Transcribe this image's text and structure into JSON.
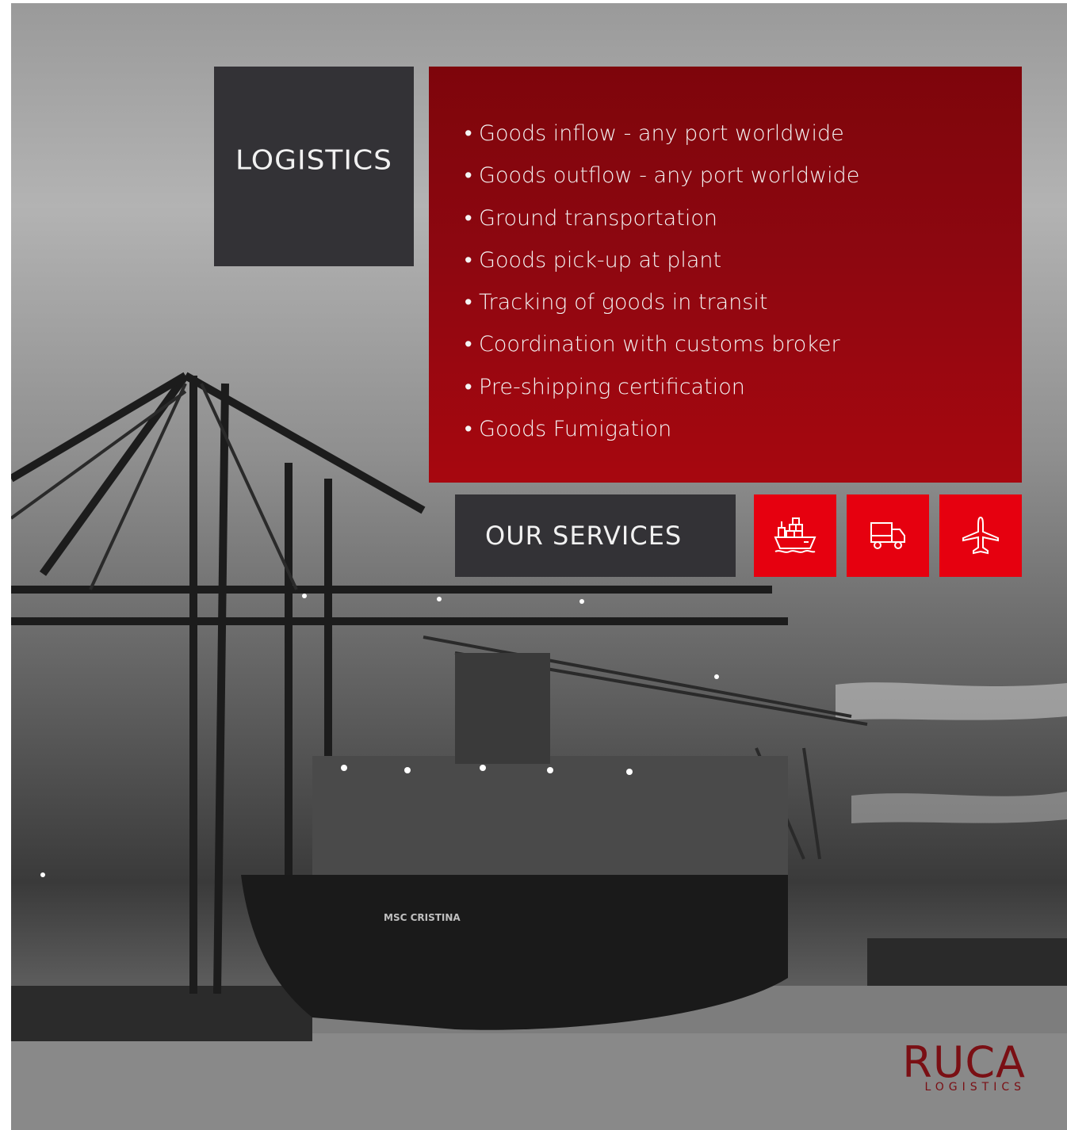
{
  "logistics_box": {
    "title": "LOGISTICS"
  },
  "services": {
    "items": [
      "• Goods inflow - any port worldwide",
      "• Goods outflow - any port worldwide",
      "• Ground transportation",
      "• Goods pick-up at plant",
      "• Tracking of goods in transit",
      "• Coordination with customs broker",
      "• Pre-shipping certification",
      "• Goods Fumigation"
    ]
  },
  "our_services": {
    "label": "OUR SERVICES"
  },
  "icons": [
    "cargo-ship-icon",
    "truck-icon",
    "airplane-icon"
  ],
  "brand": {
    "name": "RUCA",
    "subtitle": "LOGISTICS"
  },
  "colors": {
    "dark_panel": "#333236",
    "services_red": "#8d0710",
    "icon_red": "#e6000f",
    "brand_red": "#7a0f14"
  }
}
